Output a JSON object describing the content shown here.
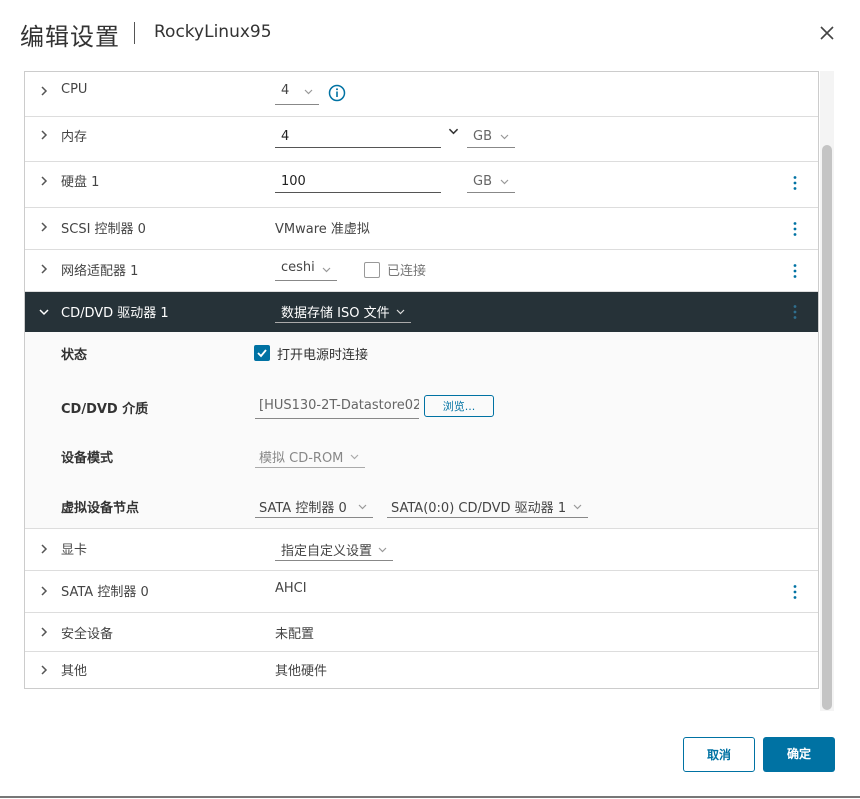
{
  "header": {
    "title": "编辑设置",
    "vm_name": "RockyLinux95"
  },
  "rows": {
    "cpu": {
      "label": "CPU",
      "value": "4"
    },
    "memory": {
      "label": "内存",
      "value": "4",
      "unit": "GB"
    },
    "disk": {
      "label": "硬盘 1",
      "value": "100",
      "unit": "GB"
    },
    "scsi": {
      "label": "SCSI 控制器 0",
      "value": "VMware 准虚拟"
    },
    "nic": {
      "label": "网络适配器 1",
      "network": "ceshi",
      "connected_label": "已连接"
    },
    "cdrom": {
      "label": "CD/DVD 驱动器 1",
      "source": "数据存储 ISO 文件",
      "status_label": "状态",
      "status_value": "打开电源时连接",
      "media_label": "CD/DVD 介质",
      "media_value": "[HUS130-2T-Datastore02",
      "browse_label": "浏览...",
      "mode_label": "设备模式",
      "mode_value": "模拟 CD-ROM",
      "node_label": "虚拟设备节点",
      "node_controller": "SATA 控制器 0",
      "node_slot": "SATA(0:0) CD/DVD 驱动器 1"
    },
    "gpu": {
      "label": "显卡",
      "value": "指定自定义设置"
    },
    "sata": {
      "label": "SATA 控制器 0",
      "value": "AHCI"
    },
    "security": {
      "label": "安全设备",
      "value": "未配置"
    },
    "other": {
      "label": "其他",
      "value": "其他硬件"
    }
  },
  "footer": {
    "cancel_label": "取消",
    "ok_label": "确定"
  },
  "colors": {
    "accent": "#0072a3",
    "selected_row": "#263238"
  }
}
